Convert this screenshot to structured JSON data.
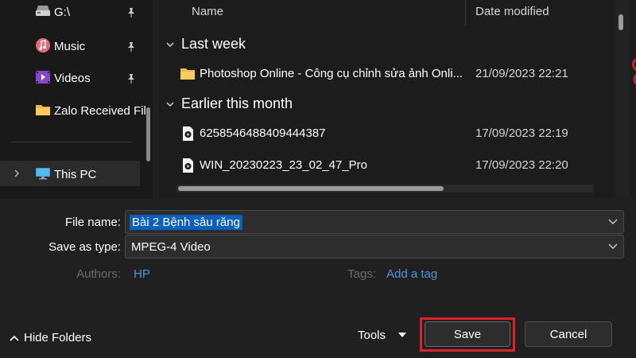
{
  "nav": {
    "items": [
      {
        "label": "G:\\",
        "icon": "drive-icon",
        "pinned": true
      },
      {
        "label": "Music",
        "icon": "music-icon",
        "pinned": true
      },
      {
        "label": "Videos",
        "icon": "videos-icon",
        "pinned": true
      },
      {
        "label": "Zalo Received Fil",
        "icon": "folder-icon",
        "pinned": false
      },
      {
        "label": "This PC",
        "icon": "pc-icon",
        "pinned": false
      }
    ]
  },
  "list": {
    "columns": {
      "name": "Name",
      "date": "Date modified"
    },
    "groups": [
      {
        "title": "Last week",
        "rows": [
          {
            "name": "Photoshop Online - Công cụ chỉnh sửa ảnh Onli...",
            "date": "21/09/2023 22:21",
            "icon": "folder-icon"
          }
        ]
      },
      {
        "title": "Earlier this month",
        "rows": [
          {
            "name": "6258546488409444387",
            "date": "17/09/2023 22:19",
            "icon": "video-file-icon"
          },
          {
            "name": "WIN_20230223_23_02_47_Pro",
            "date": "17/09/2023 22:20",
            "icon": "video-file-icon"
          }
        ]
      }
    ]
  },
  "form": {
    "file_name_label": "File name:",
    "file_name_value": "Bài 2 Bệnh sâu răng",
    "save_type_label": "Save as type:",
    "save_type_value": "MPEG-4 Video",
    "authors_label": "Authors:",
    "authors_value": "HP",
    "tags_label": "Tags:",
    "tags_value": "Add a tag"
  },
  "footer": {
    "hide_folders": "Hide Folders",
    "tools": "Tools",
    "save": "Save",
    "cancel": "Cancel"
  },
  "colors": {
    "accent": "#4b97d8",
    "selection": "#0a5fbf",
    "highlight": "#d8232a"
  }
}
